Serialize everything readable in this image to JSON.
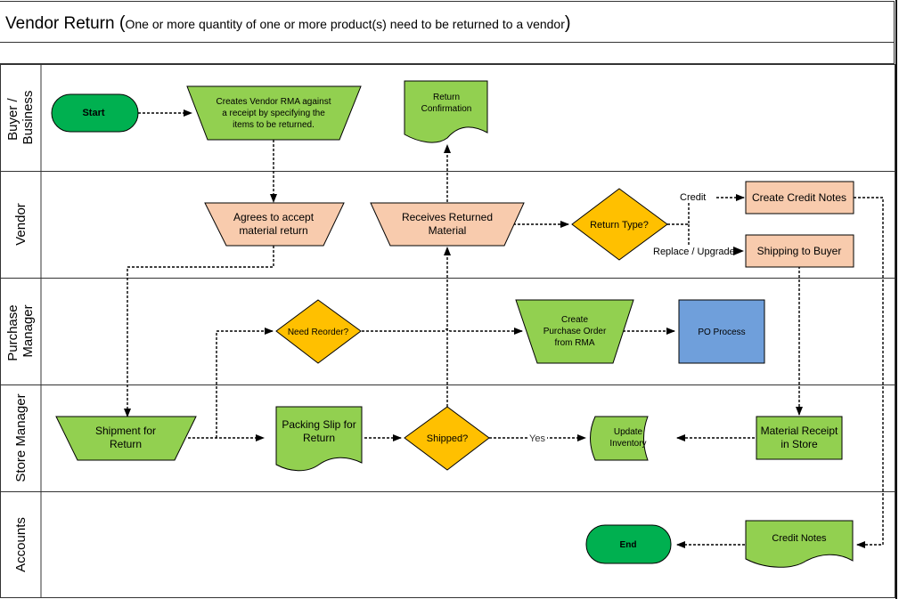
{
  "title": {
    "main": "Vendor Return",
    "open_paren": "(",
    "subtitle": "One or more quantity of one or more product(s) need to be returned to a vendor",
    "close_paren": ")"
  },
  "lanes": [
    {
      "id": "buyer",
      "label_lines": [
        "Buyer /",
        "Business"
      ]
    },
    {
      "id": "vendor",
      "label_lines": [
        "Vendor"
      ]
    },
    {
      "id": "purchase-manager",
      "label_lines": [
        "Purchase",
        "Manager"
      ]
    },
    {
      "id": "store-manager",
      "label_lines": [
        "Store Manager"
      ]
    },
    {
      "id": "accounts",
      "label_lines": [
        "Accounts"
      ]
    }
  ],
  "nodes": {
    "start": {
      "shape": "terminator",
      "lines": [
        "Start"
      ]
    },
    "create_rma": {
      "shape": "manual-operation",
      "lines": [
        "Creates Vendor RMA against",
        "a receipt by specifying the",
        "items to be returned."
      ]
    },
    "return_confirmation": {
      "shape": "document",
      "lines": [
        "Return",
        "Confirmation"
      ]
    },
    "agrees_accept": {
      "shape": "manual-operation",
      "lines": [
        "Agrees to accept",
        "material return"
      ]
    },
    "receives_returned": {
      "shape": "manual-operation",
      "lines": [
        "Receives Returned",
        "Material"
      ]
    },
    "return_type": {
      "shape": "decision",
      "lines": [
        "Return Type?"
      ]
    },
    "create_credit_notes": {
      "shape": "process",
      "lines": [
        "Create Credit Notes"
      ]
    },
    "shipping_to_buyer": {
      "shape": "process",
      "lines": [
        "Shipping to Buyer"
      ]
    },
    "need_reorder": {
      "shape": "decision",
      "lines": [
        "Need Reorder?"
      ]
    },
    "create_po": {
      "shape": "manual-operation",
      "lines": [
        "Create",
        "Purchase Order",
        "from RMA"
      ]
    },
    "po_process": {
      "shape": "process",
      "lines": [
        "PO Process"
      ]
    },
    "shipment_for_return": {
      "shape": "manual-operation",
      "lines": [
        "Shipment for",
        "Return"
      ]
    },
    "packing_slip": {
      "shape": "document",
      "lines": [
        "Packing Slip for",
        "Return"
      ]
    },
    "shipped": {
      "shape": "decision",
      "lines": [
        "Shipped?"
      ]
    },
    "update_inventory": {
      "shape": "stored-data",
      "lines": [
        "Update",
        "Inventory"
      ]
    },
    "material_receipt": {
      "shape": "process",
      "lines": [
        "Material Receipt",
        "in Store"
      ]
    },
    "end": {
      "shape": "terminator",
      "lines": [
        "End"
      ]
    },
    "credit_notes": {
      "shape": "document",
      "lines": [
        "Credit Notes"
      ]
    }
  },
  "edge_labels": {
    "credit": "Credit",
    "replace_upgrade": "Replace / Upgrade",
    "yes": "Yes"
  },
  "colors": {
    "terminator": "#00b050",
    "green": "#92d050",
    "peach": "#f8cbad",
    "decision": "#ffc000",
    "blue": "#6f9fdb",
    "line": "#000000",
    "lane_border": "#333333"
  }
}
